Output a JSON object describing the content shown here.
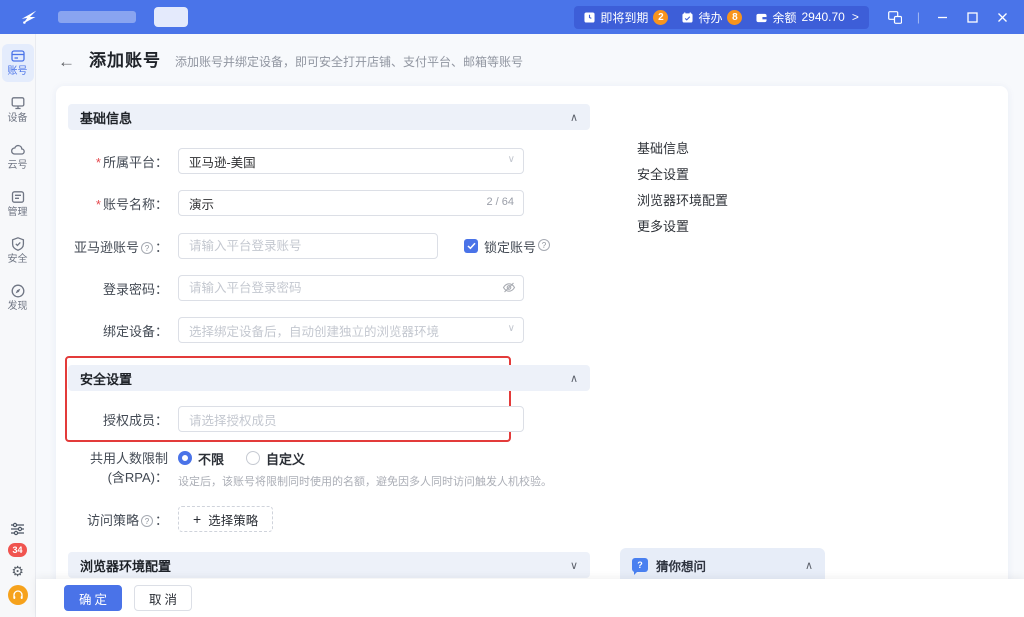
{
  "topbar": {
    "alerts": [
      {
        "label": "即将到期",
        "count": "2"
      },
      {
        "label": "待办",
        "count": "8"
      }
    ],
    "balance": {
      "label": "余额",
      "value": "2940.70",
      "arrow": ">"
    }
  },
  "sidebar": {
    "items": [
      {
        "label": "账号"
      },
      {
        "label": "设备"
      },
      {
        "label": "云号"
      },
      {
        "label": "管理"
      },
      {
        "label": "安全"
      },
      {
        "label": "发现"
      }
    ],
    "notification_count": "34"
  },
  "page": {
    "title": "添加账号",
    "subtitle": "添加账号并绑定设备，即可安全打开店铺、支付平台、邮箱等账号"
  },
  "marks": {
    "required": "*",
    "colon": "：",
    "help": "?"
  },
  "icons": {
    "back": "←",
    "chevron_down": "∨",
    "chevron_up": "∧",
    "balance_arrow": ">",
    "gear": "⚙",
    "plus": "+",
    "separator": "|"
  },
  "form": {
    "sections": {
      "basic": {
        "title": "基础信息",
        "collapse": "∧"
      },
      "security": {
        "title": "安全设置",
        "collapse": "∧"
      },
      "browser": {
        "title": "浏览器环境配置",
        "collapse": "∨"
      }
    },
    "fields": {
      "platform": {
        "label": "所属平台：",
        "value": "亚马逊-美国"
      },
      "account_name": {
        "label": "账号名称：",
        "value": "演示",
        "counter": "2 / 64"
      },
      "amazon_account": {
        "label": "亚马逊账号",
        "placeholder": "请输入平台登录账号"
      },
      "lock_account": {
        "label": "锁定账号"
      },
      "password": {
        "label": "登录密码：",
        "placeholder": "请输入平台登录密码"
      },
      "bind_device": {
        "label": "绑定设备：",
        "placeholder": "选择绑定设备后，自动创建独立的浏览器环境"
      },
      "auth_member": {
        "label": "授权成员：",
        "placeholder": "请选择授权成员"
      },
      "share_limit": {
        "label_line1": "共用人数限制",
        "label_line2": "(含RPA)：",
        "options": [
          "不限",
          "自定义"
        ],
        "hint": "设定后，该账号将限制同时使用的名额，避免因多人同时访问触发人机校验。"
      },
      "access_policy": {
        "label": "访问策略",
        "button_label": "选择策略"
      }
    }
  },
  "anchor_nav": {
    "items": [
      "基础信息",
      "安全设置",
      "浏览器环境配置",
      "更多设置"
    ]
  },
  "ask_panel": {
    "title": "猜你想问",
    "collapse": "∧"
  },
  "footer": {
    "confirm": "确定",
    "cancel": "取消"
  }
}
